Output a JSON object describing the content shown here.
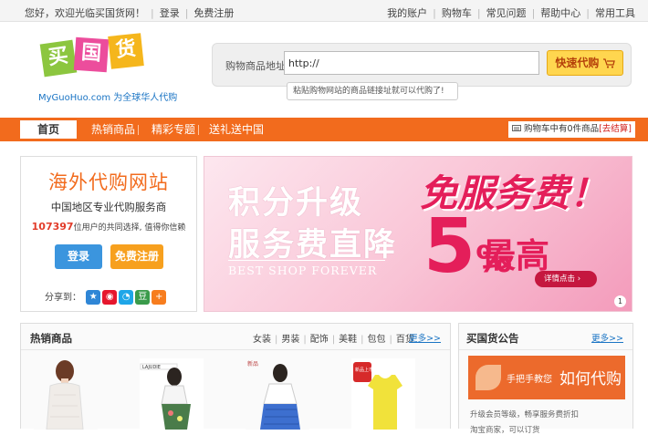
{
  "topbar": {
    "welcome": "您好，欢迎光临买国货网！",
    "login": "登录",
    "register": "免费注册",
    "links": [
      "我的账户",
      "购物车",
      "常见问题",
      "帮助中心",
      "常用工具"
    ]
  },
  "logo": {
    "chars": [
      "买",
      "国",
      "货"
    ],
    "tagline": "MyGuoHuo.com 为全球华人代购"
  },
  "search": {
    "label": "购物商品地址:",
    "value": "http://",
    "button": "快速代购",
    "tip": "粘贴购物网站的商品链接址就可以代购了!"
  },
  "nav": {
    "home": "首页",
    "items": [
      "热销商品",
      "精彩专题",
      "送礼送中国"
    ],
    "cart_text": "购物车中有0件商品",
    "cart_checkout": "[去结算]"
  },
  "intro": {
    "title": "海外代购网站",
    "subtitle": "中国地区专业代购服务商",
    "users_count": "107397",
    "users_text": "位用户的共同选择, 值得你信赖",
    "login_btn": "登录",
    "register_btn": "免费注册",
    "share_label": "分享到："
  },
  "banner": {
    "line1": "积分升级",
    "line2": "服务费直降",
    "english": "BEST SHOP FOREVER",
    "headline": "免服务费！",
    "big_number": "5",
    "percent": "%",
    "highest": "最高",
    "details_btn": "详情点击",
    "page": "1"
  },
  "hot": {
    "title": "热销商品",
    "categories": [
      "女装",
      "男装",
      "配饰",
      "美鞋",
      "包包",
      "百货"
    ],
    "more": "更多>>",
    "brand_label": "LAJUDIE",
    "promo_sticker": "新品上市"
  },
  "notice": {
    "title": "买国货公告",
    "more": "更多>>",
    "howto_small": "手把手教您",
    "howto_big": "如何代购",
    "items": [
      "升级会员等级，畅享服务费折扣",
      "淘宝商家，可以订货"
    ]
  },
  "colors": {
    "accent_orange": "#f26b1d",
    "banner_pink": "#e41e5a",
    "link_blue": "#1a74c4"
  }
}
